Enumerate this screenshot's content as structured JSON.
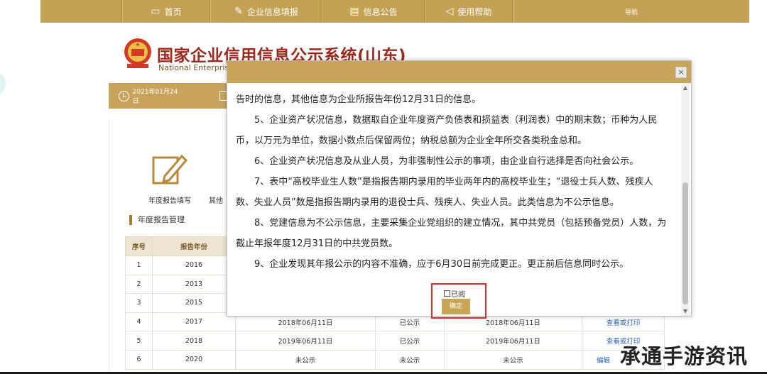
{
  "nav": {
    "home": "首页",
    "fill": "企业信息填报",
    "notice": "信息公告",
    "help": "使用帮助",
    "guide": "导航"
  },
  "header": {
    "title": "国家企业信用信息公示系统(山东)",
    "subtitle": "National Enterprise"
  },
  "datebar": {
    "date": "2021年01月24日"
  },
  "panel": {
    "quick_links": [
      "年度报告填写",
      "其他"
    ],
    "section_title": "年度报告管理",
    "columns": [
      "序号",
      "报告年份"
    ],
    "rows": [
      {
        "no": "1",
        "year": "2016",
        "c3": "",
        "c4": "",
        "c5": "",
        "action": ""
      },
      {
        "no": "2",
        "year": "2013",
        "c3": "",
        "c4": "",
        "c5": "",
        "action": ""
      },
      {
        "no": "3",
        "year": "2015",
        "c3": "",
        "c4": "",
        "c5": "",
        "action": ""
      },
      {
        "no": "4",
        "year": "2017",
        "c3": "2018年06月11日",
        "c4": "已公示",
        "c5": "2018年06月11日",
        "action": "查看或打印"
      },
      {
        "no": "5",
        "year": "2018",
        "c3": "2019年06月11日",
        "c4": "已公示",
        "c5": "2019年06月11日",
        "action": "查看或打印"
      },
      {
        "no": "6",
        "year": "2020",
        "c3": "未公示",
        "c4": "未公示",
        "c5": "未公示",
        "action": "编辑"
      }
    ]
  },
  "modal": {
    "paragraphs": [
      "告时的信息，其他信息为企业所报告年份12月31日的信息。",
      "5、企业资产状况信息，数据取自企业年度资产负债表和损益表（利润表）中的期末数；币种为人民币，以万元为单位，数据小数点后保留两位；纳税总额为企业全年所交各类税金总和。",
      "6、企业资产状况信息及从业人员，为非强制性公示的事项，由企业自行选择是否向社会公示。",
      "7、表中“高校毕业生人数”是指报告期内录用的毕业两年内的高校毕业生；“退役士兵人数、残疾人数、失业人员”数是指报告期内录用的退役士兵、残疾人、失业人员。此类信息为不公示信息。",
      "8、党建信息为不公示信息，主要采集企业党组织的建立情况，其中共党员（包括预备党员）人数，为截止年报年度12月31日的中共党员数。",
      "9、企业发现其年报公示的内容不准确，应于6月30日前完成更正。更正前后信息同时公示。"
    ],
    "read_label": "已阅",
    "confirm_label": "确定",
    "close_label": "×"
  },
  "watermark": "承通手游资讯网",
  "colors": {
    "gold": "#c4a255",
    "title_red": "#9b2a1c",
    "link_blue": "#2a61b3",
    "highlight_red": "#e02b2b"
  }
}
